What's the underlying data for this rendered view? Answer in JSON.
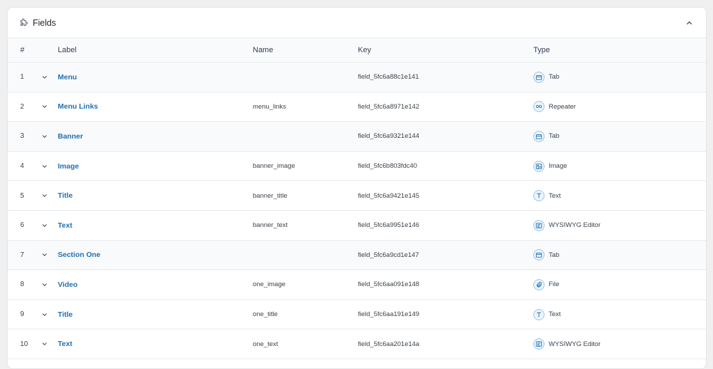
{
  "panel": {
    "title": "Fields"
  },
  "table": {
    "headers": {
      "num": "#",
      "label": "Label",
      "name": "Name",
      "key": "Key",
      "type": "Type"
    },
    "rows": [
      {
        "num": "1",
        "label": "Menu",
        "name": "",
        "key": "field_5fc6a88c1e141",
        "type": "Tab",
        "icon": "tab-icon"
      },
      {
        "num": "2",
        "label": "Menu Links",
        "name": "menu_links",
        "key": "field_5fc6a8971e142",
        "type": "Repeater",
        "icon": "repeater-icon"
      },
      {
        "num": "3",
        "label": "Banner",
        "name": "",
        "key": "field_5fc6a9321e144",
        "type": "Tab",
        "icon": "tab-icon"
      },
      {
        "num": "4",
        "label": "Image",
        "name": "banner_image",
        "key": "field_5fc6b803fdc40",
        "type": "Image",
        "icon": "image-icon"
      },
      {
        "num": "5",
        "label": "Title",
        "name": "banner_title",
        "key": "field_5fc6a9421e145",
        "type": "Text",
        "icon": "text-icon"
      },
      {
        "num": "6",
        "label": "Text",
        "name": "banner_text",
        "key": "field_5fc6a9951e146",
        "type": "WYSIWYG Editor",
        "icon": "wysiwyg-icon"
      },
      {
        "num": "7",
        "label": "Section One",
        "name": "",
        "key": "field_5fc6a9cd1e147",
        "type": "Tab",
        "icon": "tab-icon"
      },
      {
        "num": "8",
        "label": "Video",
        "name": "one_image",
        "key": "field_5fc6aa091e148",
        "type": "File",
        "icon": "file-icon"
      },
      {
        "num": "9",
        "label": "Title",
        "name": "one_title",
        "key": "field_5fc6aa191e149",
        "type": "Text",
        "icon": "text-icon"
      },
      {
        "num": "10",
        "label": "Text",
        "name": "one_text",
        "key": "field_5fc6aa201e14a",
        "type": "WYSIWYG Editor",
        "icon": "wysiwyg-icon"
      }
    ]
  },
  "colors": {
    "link": "#2271b1",
    "icon_ring": "#9ec2e6",
    "icon_fill": "#ebf5fc",
    "tab_row_bg": "#f9fafb"
  }
}
